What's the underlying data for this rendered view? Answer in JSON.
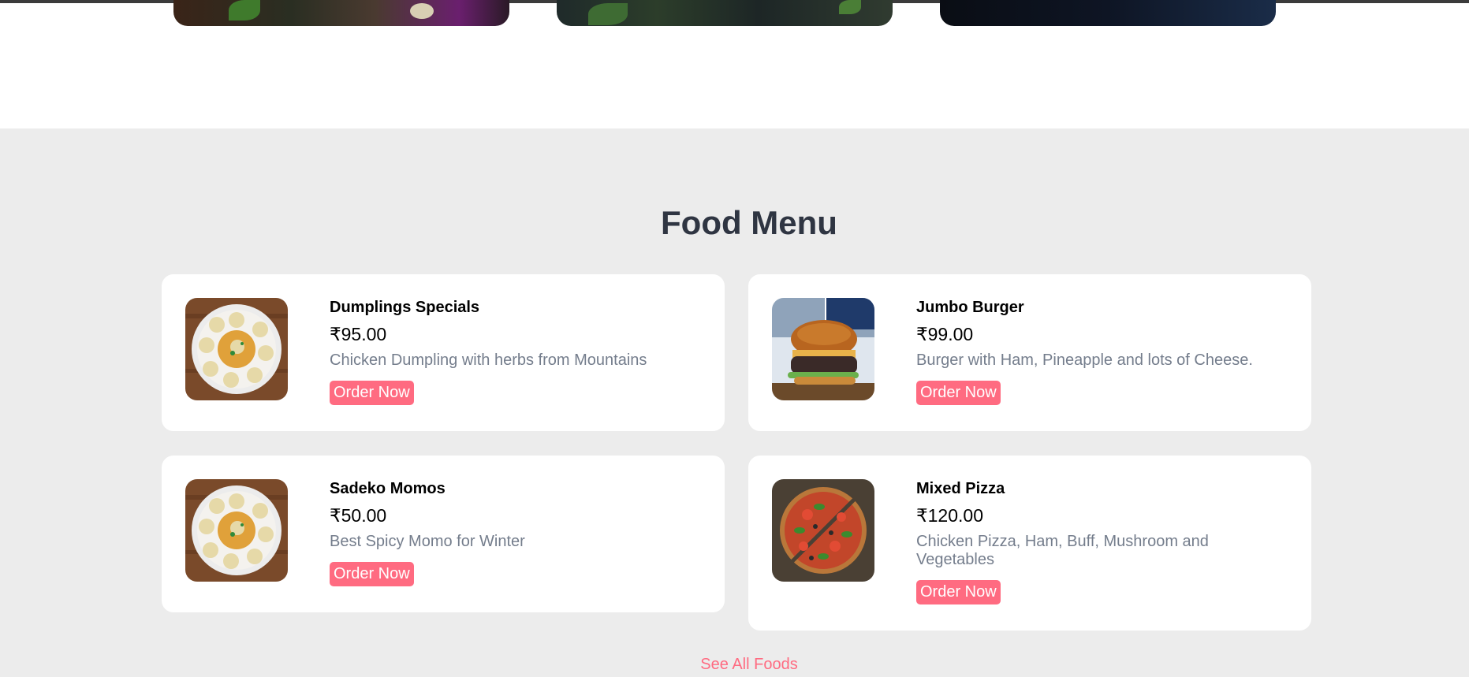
{
  "menu": {
    "title": "Food Menu",
    "items": [
      {
        "name": "Dumplings Specials",
        "price": "₹95.00",
        "description": "Chicken Dumpling with herbs from Mountains",
        "button": "Order Now",
        "image_icon": "dumplings-plate"
      },
      {
        "name": "Jumbo Burger",
        "price": "₹99.00",
        "description": "Burger with Ham, Pineapple and lots of Cheese.",
        "button": "Order Now",
        "image_icon": "burger"
      },
      {
        "name": "Sadeko Momos",
        "price": "₹50.00",
        "description": "Best Spicy Momo for Winter",
        "button": "Order Now",
        "image_icon": "dumplings-plate"
      },
      {
        "name": "Mixed Pizza",
        "price": "₹120.00",
        "description": "Chicken Pizza, Ham, Buff, Mushroom and Vegetables",
        "button": "Order Now",
        "image_icon": "pizza"
      }
    ],
    "see_all": "See All Foods"
  },
  "colors": {
    "accent": "#ff6b81",
    "section_bg": "#ececec",
    "title": "#2f3542",
    "description": "#747d8c"
  }
}
